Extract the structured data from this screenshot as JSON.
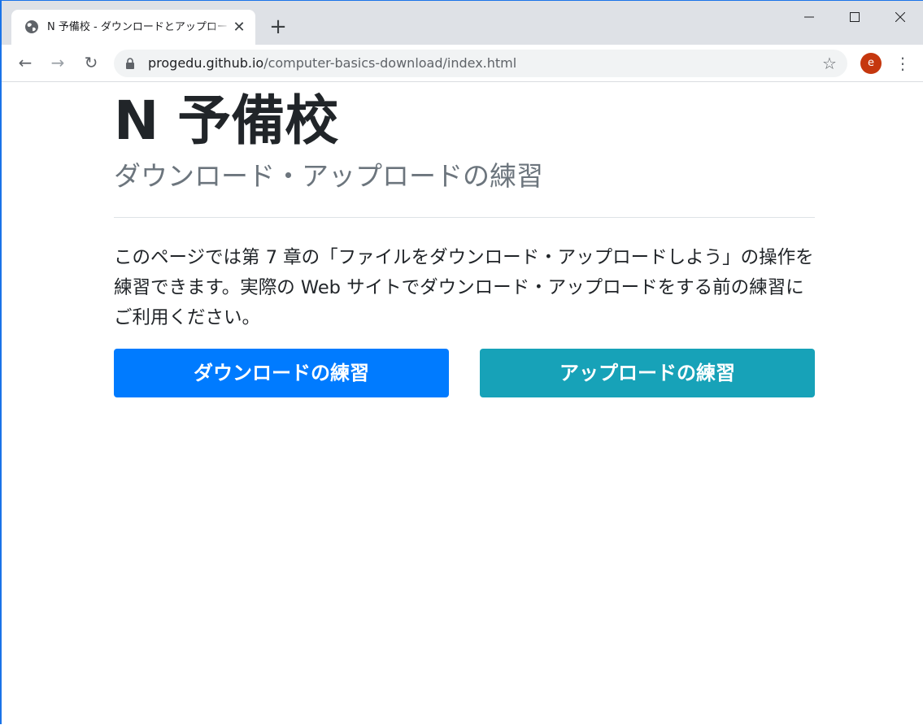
{
  "browser": {
    "tab": {
      "title": "N 予備校 - ダウンロードとアップロードの練習",
      "favicon": "globe-icon",
      "close_glyph": "✕"
    },
    "new_tab_glyph": "+",
    "window_controls": {
      "minimize": "—",
      "maximize": "☐",
      "close": "✕"
    },
    "nav": {
      "back": "←",
      "forward": "→",
      "reload": "↻"
    },
    "address": {
      "host": "progedu.github.io",
      "path": "/computer-basics-download/index.html"
    },
    "bookmark_glyph": "☆",
    "profile_initial": "e",
    "menu_glyph": "⋮"
  },
  "page": {
    "title": "N 予備校",
    "subtitle": "ダウンロード・アップロードの練習",
    "intro": "このページでは第 7 章の「ファイルをダウンロード・アップロードしよう」の操作を練習できます。実際の Web サイトでダウンロード・アップロードをする前の練習にご利用ください。",
    "buttons": {
      "download": "ダウンロードの練習",
      "upload": "アップロードの練習"
    }
  },
  "colors": {
    "download_button": "#007bff",
    "upload_button": "#17a2b8",
    "avatar": "#c5370e",
    "title_text": "#212529",
    "subtitle_text": "#6c757d"
  }
}
